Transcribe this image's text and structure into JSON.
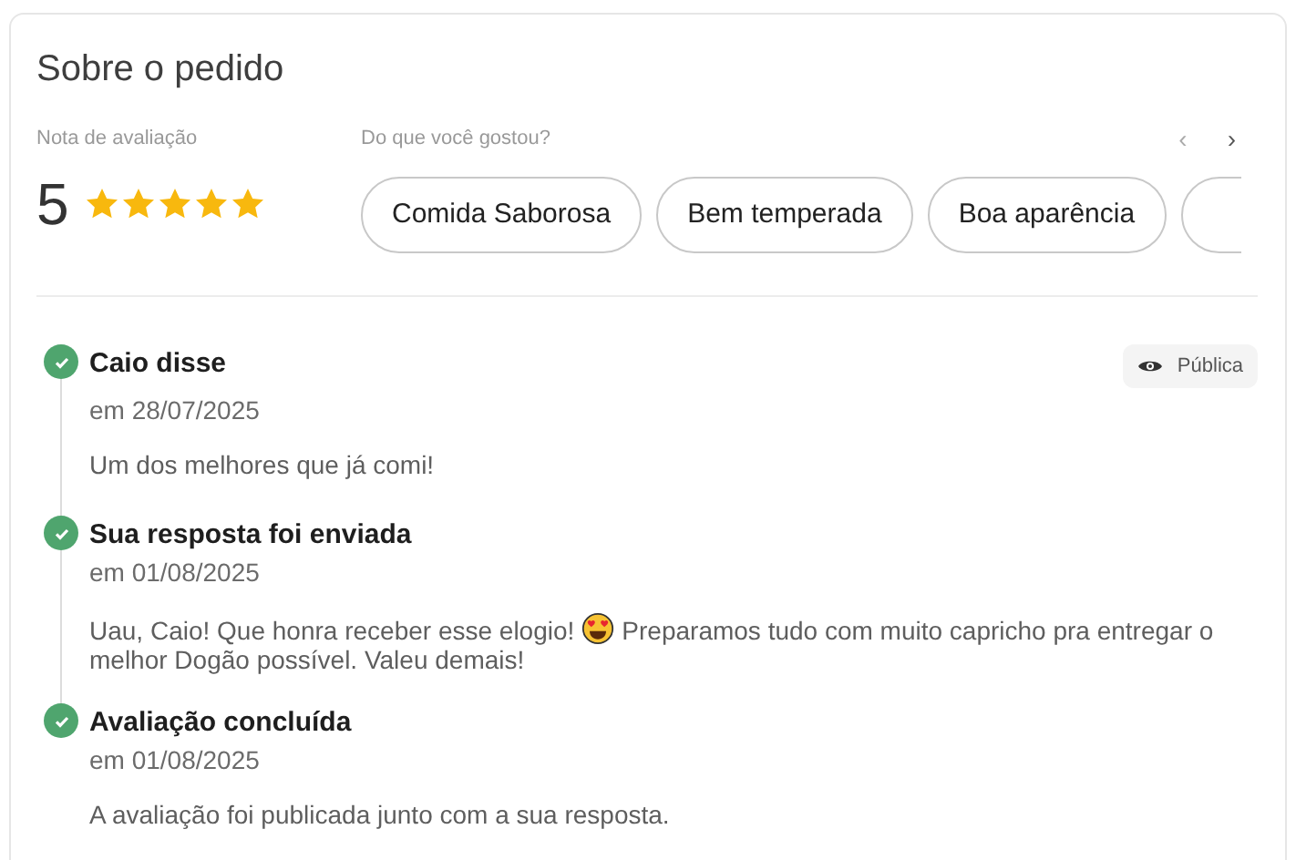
{
  "title": "Sobre o pedido",
  "rating": {
    "label": "Nota de avaliação",
    "value": "5",
    "stars": 5
  },
  "likes": {
    "label": "Do que você gostou?",
    "prev": "‹",
    "next": "›",
    "chips": [
      "Comida Saborosa",
      "Bem temperada",
      "Boa aparência"
    ],
    "cut_chip": true
  },
  "timeline": [
    {
      "title": "Caio disse",
      "date": "em 28/07/2025",
      "done": true,
      "badge": "Pública",
      "message": [
        "Um dos melhores que já comi!"
      ]
    },
    {
      "title": "Sua resposta foi enviada",
      "date": "em 01/08/2025",
      "done": true,
      "message": [
        "Uau, Caio! Que honra receber esse elogio!",
        "Preparamos tudo com muito capricho pra entregar o melhor Dogão possível. Valeu demais!"
      ]
    },
    {
      "title": "Avaliação concluída",
      "date": "em 01/08/2025",
      "done": true,
      "message": [
        "A avaliação foi publicada junto com a sua resposta."
      ]
    }
  ]
}
